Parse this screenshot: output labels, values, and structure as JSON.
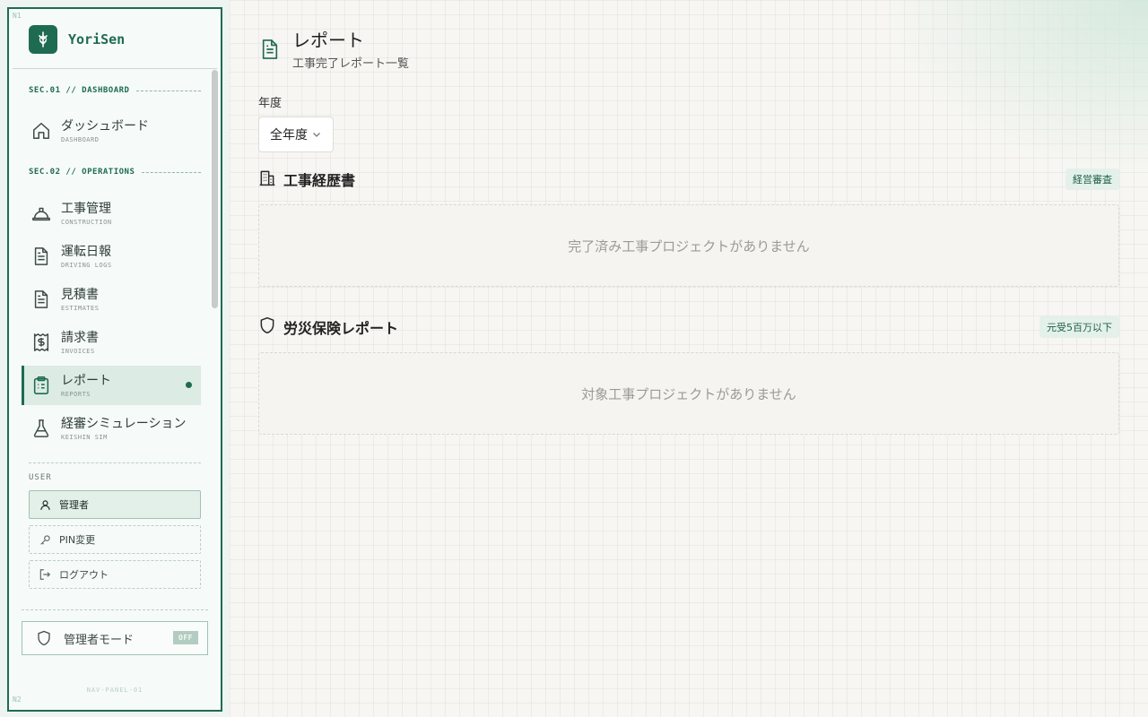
{
  "brand": {
    "name": "YoriSen"
  },
  "corners": {
    "top": "N1",
    "bottom": "N2"
  },
  "sidebar": {
    "sections": [
      {
        "label": "SEC.01 // DASHBOARD"
      },
      {
        "label": "SEC.02 // OPERATIONS"
      }
    ],
    "items": [
      {
        "label": "ダッシュボード",
        "sub": "DASHBOARD",
        "icon": "home-icon"
      },
      {
        "label": "工事管理",
        "sub": "CONSTRUCTION",
        "icon": "hardhat-icon"
      },
      {
        "label": "運転日報",
        "sub": "DRIVING LOGS",
        "icon": "document-icon"
      },
      {
        "label": "見積書",
        "sub": "ESTIMATES",
        "icon": "document-icon"
      },
      {
        "label": "請求書",
        "sub": "INVOICES",
        "icon": "invoice-icon"
      },
      {
        "label": "レポート",
        "sub": "REPORTS",
        "icon": "clipboard-icon",
        "active": true
      },
      {
        "label": "経審シミュレーション",
        "sub": "KEISHIN SIM",
        "icon": "flask-icon"
      }
    ],
    "user": {
      "heading": "USER",
      "name": "管理者",
      "pin_change": "PIN変更",
      "logout": "ログアウト"
    },
    "admin_mode": {
      "label": "管理者モード",
      "state": "OFF"
    },
    "panel_id": "NAV-PANEL-01"
  },
  "main": {
    "title": "レポート",
    "subtitle": "工事完了レポート一覧",
    "year": {
      "label": "年度",
      "selected": "全年度"
    },
    "sections": [
      {
        "title": "工事経歴書",
        "badge": "経営審査",
        "empty": "完了済み工事プロジェクトがありません"
      },
      {
        "title": "労災保険レポート",
        "badge": "元受5百万以下",
        "empty": "対象工事プロジェクトがありません"
      }
    ]
  },
  "colors": {
    "accent": "#1f6b52",
    "background": "#f7f6f2"
  }
}
